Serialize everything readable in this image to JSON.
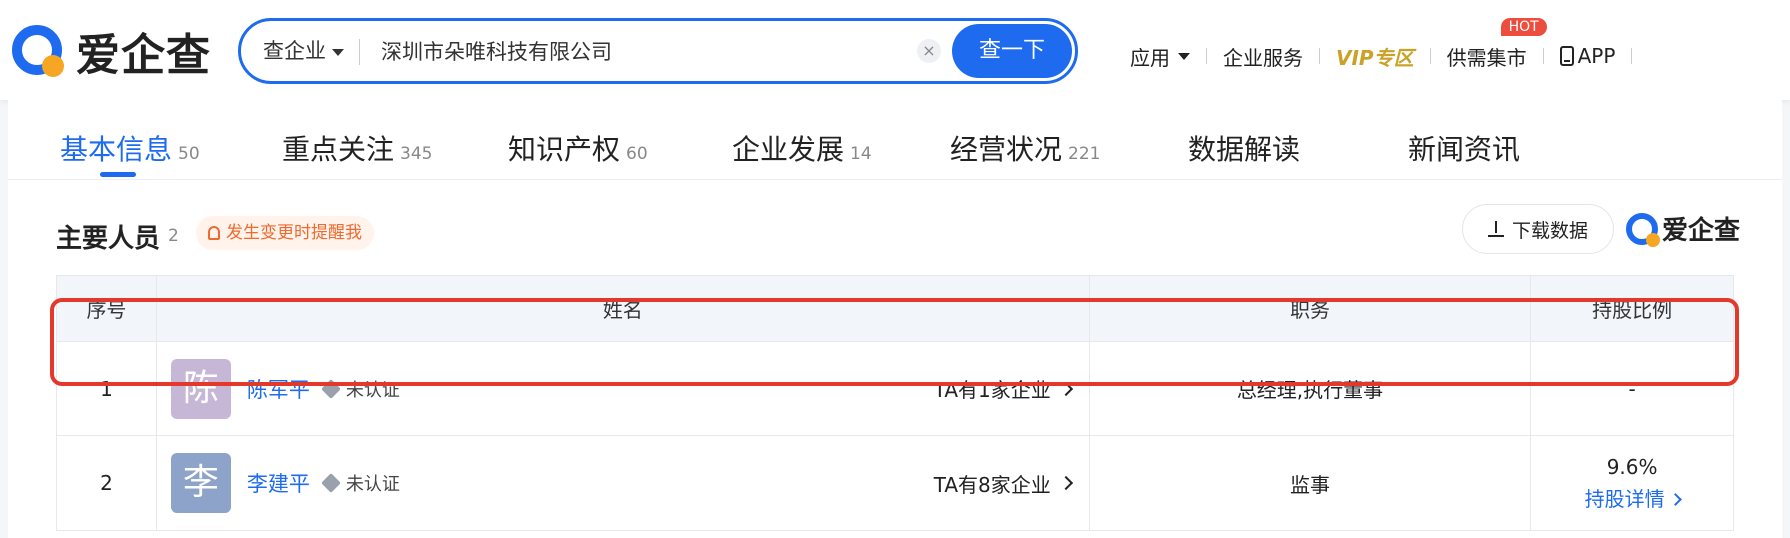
{
  "header": {
    "logo_text": "爱企查",
    "search": {
      "scope": "查企业",
      "value": "深圳市朵唯科技有限公司",
      "clear_icon": "×",
      "submit_label": "查一下"
    },
    "nav": {
      "app_menu": "应用",
      "enterprise_service": "企业服务",
      "vip": "VIP专区",
      "supply": "供需集市",
      "hot_badge": "HOT",
      "app": "APP"
    }
  },
  "tabs": [
    {
      "label": "基本信息",
      "count": "50"
    },
    {
      "label": "重点关注",
      "count": "345"
    },
    {
      "label": "知识产权",
      "count": "60"
    },
    {
      "label": "企业发展",
      "count": "14"
    },
    {
      "label": "经营状况",
      "count": "221"
    },
    {
      "label": "数据解读",
      "count": ""
    },
    {
      "label": "新闻资讯",
      "count": ""
    }
  ],
  "section": {
    "title": "主要人员",
    "count": "2",
    "remind_label": "发生变更时提醒我",
    "download_label": "下载数据",
    "brand": "爱企查"
  },
  "table": {
    "headers": [
      "序号",
      "姓名",
      "职务",
      "持股比例"
    ],
    "rows": [
      {
        "index": "1",
        "avatar_char": "陈",
        "avatar_color": "#c7b7d6",
        "name": "陈军平",
        "cert": "未认证",
        "companies": "TA有1家企业",
        "position": "总经理,执行董事",
        "share": "-"
      },
      {
        "index": "2",
        "avatar_char": "李",
        "avatar_color": "#8ea3c9",
        "name": "李建平",
        "cert": "未认证",
        "companies": "TA有8家企业",
        "position": "监事",
        "share": "9.6%",
        "share_link": "持股详情"
      }
    ]
  },
  "colors": {
    "accent": "#1e6bf0",
    "highlight": "#e3392a",
    "vip": "#c9a227",
    "hot": "#ec4d3e"
  }
}
